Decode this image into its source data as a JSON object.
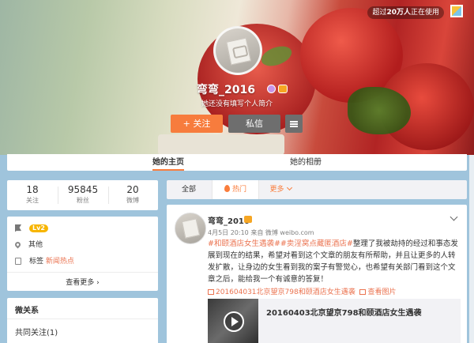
{
  "cover": {
    "online_badge_prefix": "超过",
    "online_badge_count": "20万人",
    "online_badge_suffix": "正在使用"
  },
  "profile": {
    "nickname": "弯弯_2016",
    "intro": "她还没有填写个人简介",
    "follow_label": "+ 关注",
    "message_label": "私信"
  },
  "tabs": {
    "home": "她的主页",
    "album": "她的相册"
  },
  "stats": [
    {
      "num": "18",
      "label": "关注"
    },
    {
      "num": "95845",
      "label": "粉丝"
    },
    {
      "num": "20",
      "label": "微博"
    }
  ],
  "info": {
    "level": "Lv2",
    "location": "其他",
    "tags_label": "标签",
    "tag_value": "新闻热点",
    "see_more": "查看更多 ›"
  },
  "micro": {
    "title": "微关系",
    "common_follow": "共同关注(1)"
  },
  "filter": {
    "all": "全部",
    "hot": "热门",
    "more": "更多"
  },
  "post": {
    "name": "弯弯_2016",
    "meta": "4月5日 20:10 来自 微博 weibo.com",
    "hashtag1": "#和颐酒店女生遇袭#",
    "hashtag2": "#卖淫窝点藏匿酒店#",
    "body": "整理了我被劫持的经过和事态发展到现在的结果，希望对看到这个文章的朋友有所帮助，并且让更多的人转发扩散，让身边的女生看到我的案子有警觉心，也希望有关部门看到这个文章之后，能给我一个有诚意的答复！",
    "link_video": "201604031北京望京798和颐酒店女生遇袭",
    "link_images": "查看图片",
    "card_title": "20160403北京望京798和颐酒店女生遇袭"
  },
  "colors": {
    "accent": "#fa7d3c",
    "link": "#eb7350",
    "background": "#9fc4dc"
  }
}
